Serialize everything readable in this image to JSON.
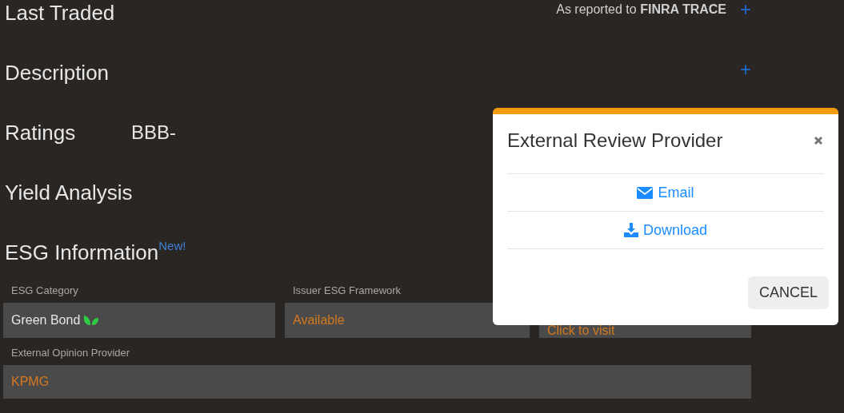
{
  "sections": [
    {
      "title": "Last Traded",
      "note": "As reported to **FINRA TRACE**",
      "expandable": true
    },
    {
      "title": "Description",
      "expandable": true
    },
    {
      "title": "Ratings",
      "value": "BBB-",
      "expandable": false
    },
    {
      "title": "Yield Analysis",
      "expandable": false
    },
    {
      "title": "ESG Information",
      "badge": "New!",
      "expandable": false
    }
  ],
  "esg_fields": [
    {
      "label": "ESG Category",
      "value": "Green Bond",
      "link": false,
      "leaf": true
    },
    {
      "label": "Issuer ESG Framework",
      "value": "Available",
      "link": true,
      "leaf": false
    },
    {
      "value": "Click to visit",
      "link": true,
      "leaf": false
    }
  ],
  "external_opinion": {
    "label": "External Opinion Provider",
    "value": "KPMG",
    "link": true
  },
  "modal": {
    "title": "External Review Provider",
    "actions": [
      {
        "kind": "email",
        "label": "Email"
      },
      {
        "kind": "download",
        "label": "Download"
      }
    ],
    "cancel": "CANCEL"
  }
}
